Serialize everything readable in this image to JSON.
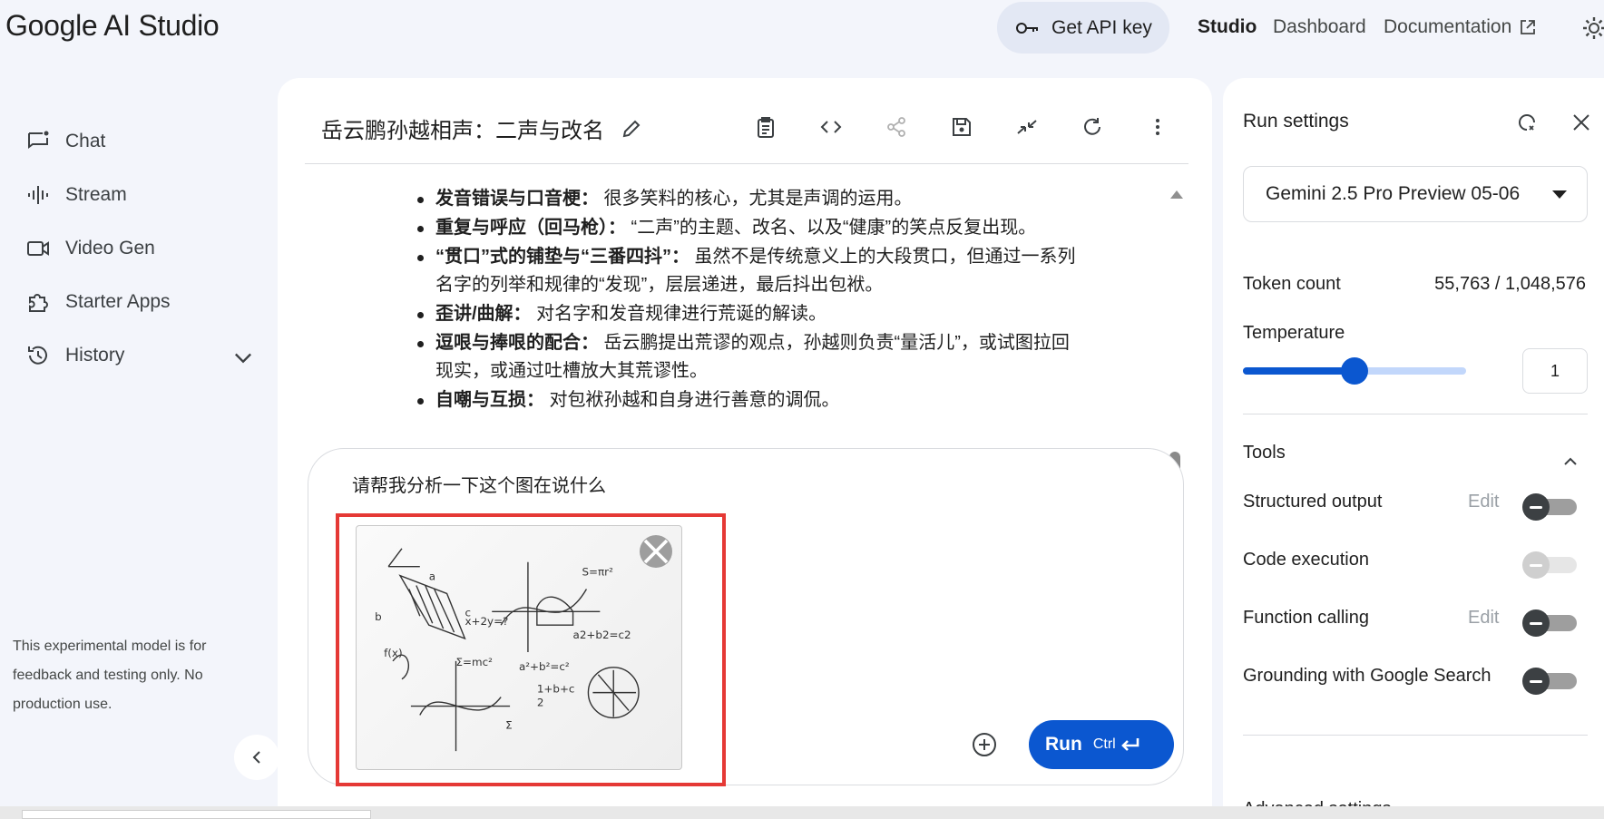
{
  "header": {
    "logo": "Google AI Studio",
    "api_key_label": "Get API key",
    "nav_studio": "Studio",
    "nav_dashboard": "Dashboard",
    "nav_docs": "Documentation"
  },
  "sidebar": {
    "items": [
      {
        "label": "Chat",
        "icon": "chat-icon"
      },
      {
        "label": "Stream",
        "icon": "stream-icon"
      },
      {
        "label": "Video Gen",
        "icon": "video-icon"
      },
      {
        "label": "Starter Apps",
        "icon": "puzzle-icon"
      },
      {
        "label": "History",
        "icon": "history-icon"
      }
    ],
    "disclaimer": "This experimental model is for feedback and testing only. No production use."
  },
  "main": {
    "title": "岳云鹏孙越相声：二声与改名",
    "content": [
      {
        "bold": "发音错误与口音梗：",
        "text": " 很多笑料的核心，尤其是声调的运用。"
      },
      {
        "bold": "重复与呼应（回马枪）：",
        "text": " “二声”的主题、改名、以及“健康”的笑点反复出现。"
      },
      {
        "bold": "“贯口”式的铺垫与“三番四抖”：",
        "text": " 虽然不是传统意义上的大段贯口，但通过一系列名字的列举和规律的“发现”，层层递进，最后抖出包袱。"
      },
      {
        "bold": "歪讲/曲解：",
        "text": " 对名字和发音规律进行荒诞的解读。"
      },
      {
        "bold": "逗哏与捧哏的配合：",
        "text": " 岳云鹏提出荒谬的观点，孙越则负责“量活儿”，或试图拉回现实，或通过吐槽放大其荒谬性。"
      },
      {
        "bold": "自嘲与互损：",
        "text": " 对包袱孙越和自身进行善意的调侃。"
      }
    ],
    "prompt_text": "请帮我分析一下这个图在说什么",
    "run_label": "Run",
    "run_shortcut": "Ctrl"
  },
  "run_settings": {
    "title": "Run settings",
    "model": "Gemini 2.5 Pro Preview 05-06",
    "token_label": "Token count",
    "token_value": "55,763 / 1,048,576",
    "temperature_label": "Temperature",
    "temperature_value": "1",
    "temperature_fraction": 0.5,
    "tools_label": "Tools",
    "tools": [
      {
        "label": "Structured output",
        "edit": "Edit",
        "state": "off"
      },
      {
        "label": "Code execution",
        "edit": "",
        "state": "disabled"
      },
      {
        "label": "Function calling",
        "edit": "Edit",
        "state": "off"
      },
      {
        "label": "Grounding with Google Search",
        "edit": "",
        "state": "off"
      }
    ],
    "advanced_label": "Advanced settings"
  },
  "colors": {
    "accent": "#0b57d0",
    "highlight_border": "#e53935"
  }
}
